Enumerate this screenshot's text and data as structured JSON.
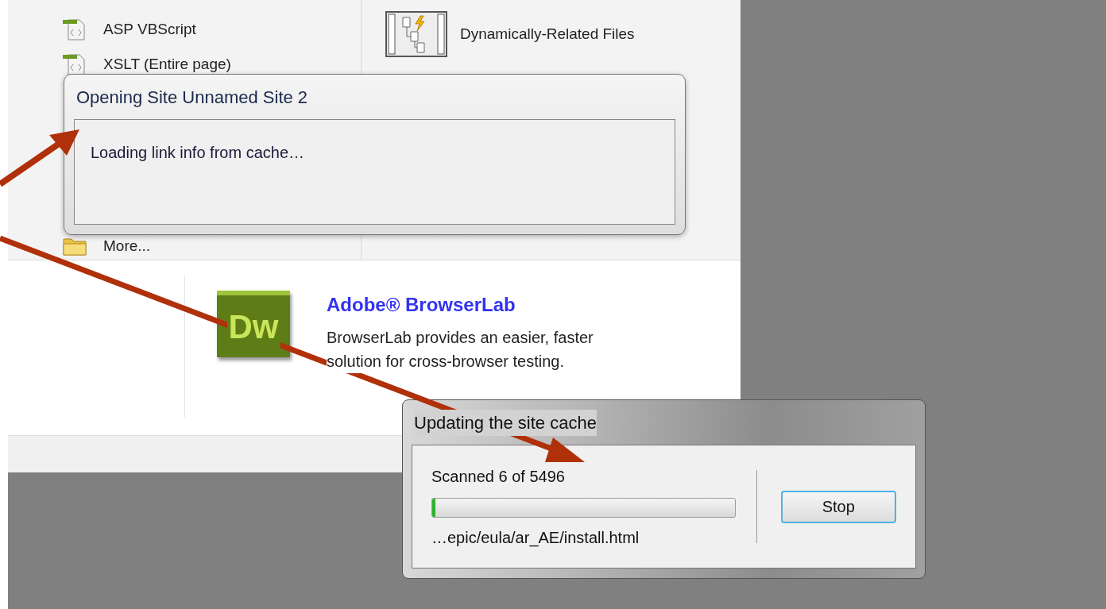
{
  "start_page": {
    "templates": [
      {
        "kind": "file",
        "label": "ASP VBScript"
      },
      {
        "kind": "file",
        "label": "XSLT (Entire page)"
      },
      {
        "kind": "folder",
        "label": "More..."
      }
    ],
    "features": [
      {
        "kind": "filmstrip",
        "label": "Dynamically-Related Files"
      }
    ],
    "promo": {
      "logo": "Dw",
      "title": "Adobe® BrowserLab",
      "text": "BrowserLab provides an easier, faster solution for cross-browser testing."
    }
  },
  "opening_dialog": {
    "title": "Opening Site Unnamed Site 2",
    "message": "Loading link info from cache…"
  },
  "cache_dialog": {
    "title": "Updating the site cache",
    "status": "Scanned 6 of 5496",
    "progress": {
      "level": 0.01
    },
    "path": "…epic/eula/ar_AE/install.html",
    "button": "Stop"
  }
}
